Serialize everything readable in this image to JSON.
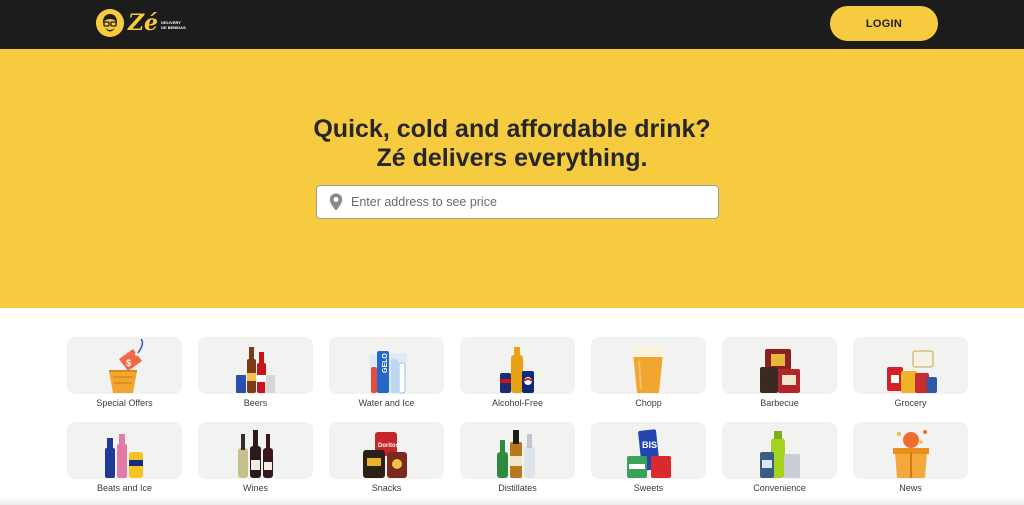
{
  "header": {
    "logo_word": "Zé",
    "logo_tagline_1": "DELIVERY",
    "logo_tagline_2": "DE BEBIDAS",
    "login_label": "LOGIN"
  },
  "hero": {
    "title_line1": "Quick, cold and affordable drink?",
    "title_line2": "Zé delivers everything.",
    "search_placeholder": "Enter address to see price"
  },
  "categories": [
    {
      "label": "Special Offers",
      "icon": "price-tag-basket-icon"
    },
    {
      "label": "Beers",
      "icon": "beer-bottles-icon"
    },
    {
      "label": "Water and Ice",
      "icon": "water-ice-icon"
    },
    {
      "label": "Alcohol-Free",
      "icon": "soda-icon"
    },
    {
      "label": "Chopp",
      "icon": "draft-beer-glass-icon"
    },
    {
      "label": "Barbecue",
      "icon": "barbecue-icon"
    },
    {
      "label": "Grocery",
      "icon": "grocery-icon"
    },
    {
      "label": "Beats and Ice",
      "icon": "beats-ice-icon"
    },
    {
      "label": "Wines",
      "icon": "wine-bottles-icon"
    },
    {
      "label": "Snacks",
      "icon": "snacks-icon"
    },
    {
      "label": "Distillates",
      "icon": "liquor-bottles-icon"
    },
    {
      "label": "Sweets",
      "icon": "sweets-icon"
    },
    {
      "label": "Convenience",
      "icon": "convenience-icon"
    },
    {
      "label": "News",
      "icon": "gift-box-icon"
    }
  ],
  "colors": {
    "brand_yellow": "#f6cb3f",
    "header_dark": "#1c1c1c",
    "card_bg": "#f2f2f1",
    "text_dark": "#262626"
  }
}
